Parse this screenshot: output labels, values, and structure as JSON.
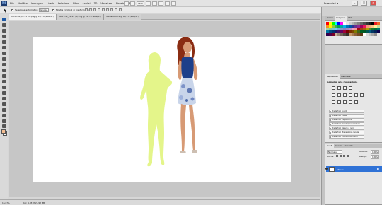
{
  "app": {
    "logo": "Ps",
    "menu": [
      "File",
      "Modifica",
      "Immagine",
      "Livello",
      "Selezione",
      "Filtro",
      "Analisi",
      "3D",
      "Visualizza",
      "Finestra",
      "Aiuto"
    ],
    "zoom": "16,7",
    "workspace": "Essenziali",
    "window_controls": [
      "–",
      "□",
      "×"
    ]
  },
  "options": {
    "auto_select_label": "Seleziona automatico:",
    "auto_select_value": "Gruppo",
    "transform_label": "Mostra controlli di trasformazione"
  },
  "documents": {
    "tabs": [
      {
        "label": "08-07-12_22-15 (2).png @ 16,7% (RGB/8*)",
        "active": true
      },
      {
        "label": "08-07-12_22-15 (4).png @ 16,7% (RGB/8*)",
        "active": false
      },
      {
        "label": "Senza titolo-1 @ 66,7% (RGB/8*)",
        "active": false
      }
    ]
  },
  "status": {
    "zoom": "16,67%",
    "doc": "Doc: 5,93 MB/5,93 MB"
  },
  "panels": {
    "color_tabs": [
      "Colore",
      "Campioni",
      "Stili"
    ],
    "swatches": [
      "#ff0000",
      "#ffff00",
      "#00ff00",
      "#00ffff",
      "#0000ff",
      "#ff00ff",
      "#ffffff",
      "#e6e6e6",
      "#cccccc",
      "#b3b3b3",
      "#999999",
      "#808080",
      "#666666",
      "#4d4d4d",
      "#333333",
      "#1a1a1a",
      "#000000",
      "#ed1c24",
      "#f26522",
      "#f7941d",
      "#fff200",
      "#8dc63f",
      "#39b54a",
      "#00a651",
      "#00a99d",
      "#00aeef",
      "#0072bc",
      "#0054a6",
      "#2e3192",
      "#662d91",
      "#92278f",
      "#9e005d",
      "#ed145b",
      "#f69679",
      "#f9ad81",
      "#fdc689",
      "#fff799",
      "#c4df9b",
      "#a3d39c",
      "#82ca9c",
      "#7accc8",
      "#6dcff6",
      "#7da7d9",
      "#8393ca",
      "#8781bd",
      "#a186be",
      "#bd8cbf",
      "#f49ac1",
      "#f5989d",
      "#9e0b0f",
      "#a0410d",
      "#a3620a",
      "#aba000",
      "#598527",
      "#197b30",
      "#007236",
      "#00746b",
      "#0076a3",
      "#004a80",
      "#003471",
      "#1b1464",
      "#440e62",
      "#630460",
      "#9e0039",
      "#790000",
      "#7b2e00",
      "#7d4900",
      "#827b00",
      "#406618",
      "#005e20",
      "#005826",
      "#005952",
      "#005b7f",
      "#003663",
      "#002157",
      "#0d004c",
      "#32004b",
      "#4b0049",
      "#7a0026",
      "#c7b299",
      "#998675",
      "#736357",
      "#534741",
      "#37302a",
      "#c69c6d",
      "#a67c52",
      "#8c6239",
      "#754c24",
      "#603913",
      "#ffffff",
      "#d9d9d9",
      "#bfbfbf",
      "#a6a6a6",
      "#8c8c8c"
    ],
    "adjust_tabs": [
      "Regolazioni",
      "Maschere"
    ],
    "adjust_title": "Aggiungi una regolazione",
    "presets": [
      "Predefiniti Livelli",
      "Predefiniti Curve",
      "Predefiniti Esposizione",
      "Predefiniti Tonalità/saturazione",
      "Predefiniti Bianco e nero",
      "Predefiniti Miscelatore canale",
      "Predefiniti Correzione colore"
    ],
    "layers_tabs": [
      "Livelli",
      "Canali",
      "Tracciati"
    ],
    "blend_mode": "Normale",
    "opacity_label": "Opacità:",
    "opacity_value": "100%",
    "lock_label": "Blocca:",
    "fill_label": "Riemp.:",
    "fill_value": "100%",
    "layer_name": "Sfondo"
  },
  "colors": {
    "accent": "#2f72d6",
    "ghost": "#e4f58a",
    "dress_top": "#1d3f8a",
    "skirt": "#c9d5ea"
  }
}
